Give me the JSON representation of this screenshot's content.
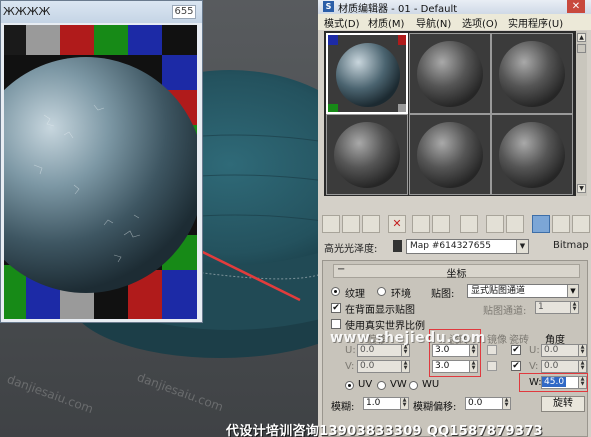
{
  "viewport": {
    "map_window": {
      "title": "ЖЖЖЖ",
      "number_box": "655"
    },
    "watermarks": [
      "danjiesaiu.com",
      "danjiesaiu.com"
    ]
  },
  "editor": {
    "title": "材质编辑器 - 01 - Default",
    "title_icon": "S",
    "menu": [
      "模式(D)",
      "材质(M)",
      "导航(N)",
      "选项(O)",
      "实用程序(U)"
    ],
    "map_row": {
      "label": "高光光泽度:",
      "map_name": "Map #614327655",
      "map_type": "Bitmap"
    },
    "coordinates": {
      "title": "坐标",
      "radio_texture": "纹理",
      "radio_environ": "环境",
      "mapping_label": "贴图:",
      "mapping_value": "显式贴图通道",
      "check_show_back": "在背面显示贴图",
      "map_channel_label": "贴图通道:",
      "map_channel_value": "1",
      "check_real_world": "使用真实世界比例",
      "col_offset": "偏移",
      "col_tiling": "瓷砖",
      "col_mirror": "镜像",
      "col_tile": "瓷砖",
      "col_angle": "角度",
      "u_label": "U:",
      "v_label": "V:",
      "w_label": "W:",
      "u_offset": "0.0",
      "v_offset": "0.0",
      "u_tiling": "3.0",
      "v_tiling": "3.0",
      "u_angle": "0.0",
      "v_angle": "0.0",
      "w_angle": "45.0",
      "radio_uv": "UV",
      "radio_vw": "VW",
      "radio_wu": "WU",
      "blur_label": "模糊:",
      "blur_value": "1.0",
      "blur_offset_label": "模糊偏移:",
      "blur_offset_value": "0.0",
      "rotate_button": "旋转"
    }
  },
  "overlays": {
    "watermark_site": "www.shejiedu.com",
    "footer_text": "代设计培训咨询13903833309 QQ1587879373"
  },
  "colors": {
    "arrow": "#e23c3c",
    "highlight": "#3169c6",
    "red_box": "#e0393e"
  }
}
